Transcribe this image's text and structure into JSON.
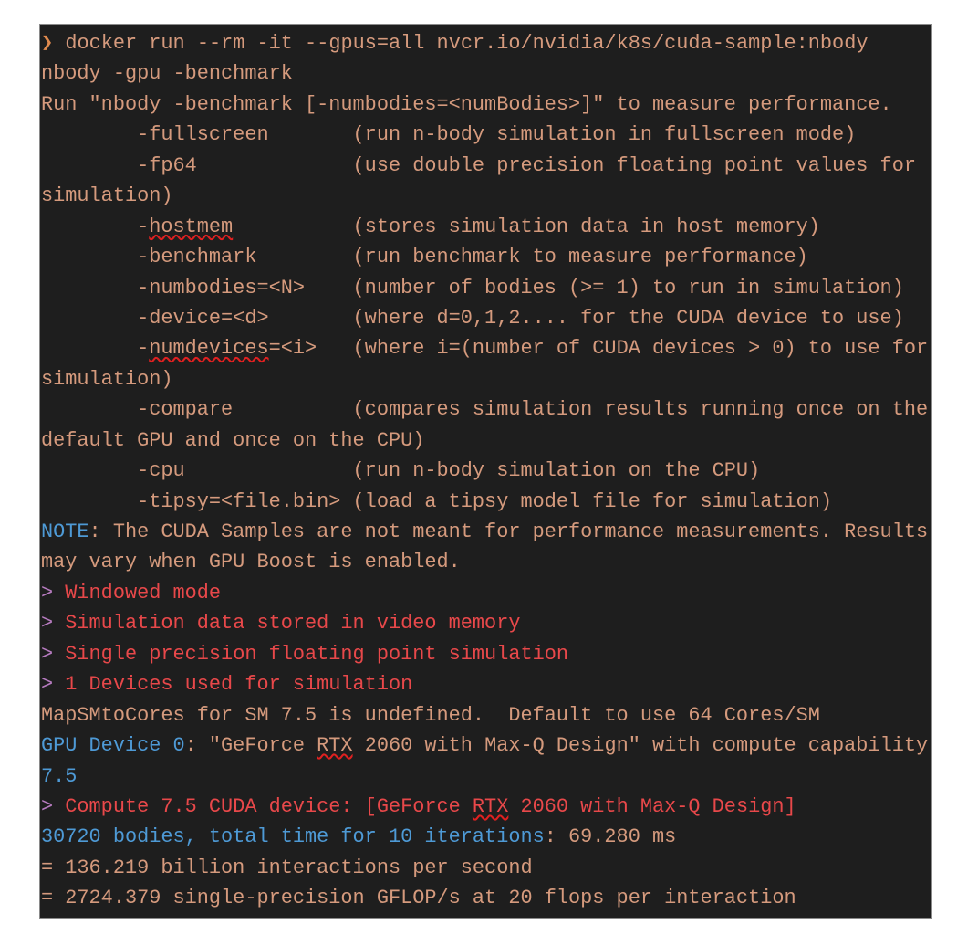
{
  "terminal": {
    "colors": {
      "background": "#1e1e1e",
      "text": "#d59a7d",
      "info_blue": "#4e9ad6",
      "warning_red": "#e8484a",
      "marker_purple": "#b77bc0",
      "prompt_orange": "#e08a4e"
    },
    "prompt_icon": "chevron-right-icon",
    "lines": [
      {
        "segments": [
          {
            "t": "❯",
            "c": "prompt"
          },
          {
            "t": " docker run --rm -it --gpus=all nvcr.io/nvidia/k8s/cuda-sample:nbody",
            "c": "text"
          }
        ]
      },
      {
        "segments": [
          {
            "t": "nbody -gpu -benchmark",
            "c": "text"
          }
        ]
      },
      {
        "segments": [
          {
            "t": "Run \"nbody -benchmark [-numbodies=<numBodies>]\" to measure performance.",
            "c": "text"
          }
        ]
      },
      {
        "segments": [
          {
            "t": "        -fullscreen       (run n-body simulation in fullscreen mode)",
            "c": "text"
          }
        ]
      },
      {
        "segments": [
          {
            "t": "        -fp64             (use double precision floating point values for",
            "c": "text"
          }
        ]
      },
      {
        "segments": [
          {
            "t": "simulation)",
            "c": "text"
          }
        ]
      },
      {
        "segments": [
          {
            "t": "        -",
            "c": "text"
          },
          {
            "t": "hostmem",
            "c": "text",
            "spell": true
          },
          {
            "t": "          (stores simulation data in host memory)",
            "c": "text"
          }
        ]
      },
      {
        "segments": [
          {
            "t": "        -benchmark        (run benchmark to measure performance)",
            "c": "text"
          }
        ]
      },
      {
        "segments": [
          {
            "t": "        -numbodies=<N>    (number of bodies (>= 1) to run in simulation)",
            "c": "text"
          }
        ]
      },
      {
        "segments": [
          {
            "t": "        -device=<d>       (where d=0,1,2.... for the CUDA device to use)",
            "c": "text"
          }
        ]
      },
      {
        "segments": [
          {
            "t": "        -",
            "c": "text"
          },
          {
            "t": "numdevices",
            "c": "text",
            "spell": true
          },
          {
            "t": "=<i>   (where i=(number of CUDA devices > 0) to use for",
            "c": "text"
          }
        ]
      },
      {
        "segments": [
          {
            "t": "simulation)",
            "c": "text"
          }
        ]
      },
      {
        "segments": [
          {
            "t": "        -compare          (compares simulation results running once on the",
            "c": "text"
          }
        ]
      },
      {
        "segments": [
          {
            "t": "default GPU and once on the CPU)",
            "c": "text"
          }
        ]
      },
      {
        "segments": [
          {
            "t": "        -cpu              (run n-body simulation on the CPU)",
            "c": "text"
          }
        ]
      },
      {
        "segments": [
          {
            "t": "        -tipsy=<file.bin> (load a tipsy model file for simulation)",
            "c": "text"
          }
        ]
      },
      {
        "segments": [
          {
            "t": "NOTE",
            "c": "blue"
          },
          {
            "t": ": The CUDA Samples are not meant for performance measurements. Results",
            "c": "text"
          }
        ]
      },
      {
        "segments": [
          {
            "t": "may vary when GPU Boost is enabled.",
            "c": "text"
          }
        ]
      },
      {
        "segments": [
          {
            "t": ">",
            "c": "purple"
          },
          {
            "t": " Windowed mode",
            "c": "red"
          }
        ]
      },
      {
        "segments": [
          {
            "t": ">",
            "c": "purple"
          },
          {
            "t": " Simulation data stored in video memory",
            "c": "red"
          }
        ]
      },
      {
        "segments": [
          {
            "t": ">",
            "c": "purple"
          },
          {
            "t": " Single precision floating point simulation",
            "c": "red"
          }
        ]
      },
      {
        "segments": [
          {
            "t": ">",
            "c": "purple"
          },
          {
            "t": " 1 Devices used for simulation",
            "c": "red"
          }
        ]
      },
      {
        "segments": [
          {
            "t": "MapSMtoCores for SM 7.5 is undefined.  Default to use 64 Cores/SM",
            "c": "text"
          }
        ]
      },
      {
        "segments": [
          {
            "t": "GPU Device 0",
            "c": "blue"
          },
          {
            "t": ": \"GeForce ",
            "c": "text"
          },
          {
            "t": "RTX",
            "c": "text",
            "spell": true
          },
          {
            "t": " 2060 with Max-Q Design\" with compute capability",
            "c": "text"
          }
        ]
      },
      {
        "segments": [
          {
            "t": "7.5",
            "c": "blue"
          }
        ]
      },
      {
        "segments": [
          {
            "t": ">",
            "c": "purple"
          },
          {
            "t": " Compute 7.5 CUDA device: [GeForce ",
            "c": "red"
          },
          {
            "t": "RTX",
            "c": "red",
            "spell": true
          },
          {
            "t": " 2060 with Max-Q Design]",
            "c": "red"
          }
        ]
      },
      {
        "segments": [
          {
            "t": "30720 bodies, total time for 10 iterations",
            "c": "blue"
          },
          {
            "t": ": 69.280 ms",
            "c": "text"
          }
        ]
      },
      {
        "segments": [
          {
            "t": "= 136.219 billion interactions per second",
            "c": "text"
          }
        ]
      },
      {
        "segments": [
          {
            "t": "= 2724.379 single-precision GFLOP/s at 20 flops per interaction",
            "c": "text"
          }
        ]
      }
    ]
  }
}
